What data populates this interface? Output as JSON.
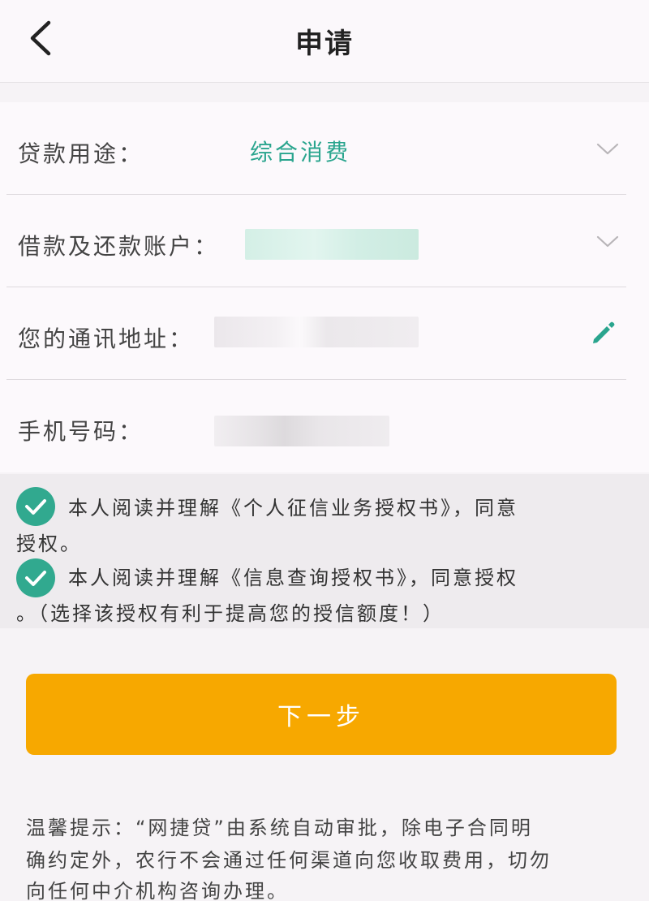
{
  "header": {
    "title": "申请",
    "back_icon": "chevron-left-icon"
  },
  "form": {
    "purpose": {
      "label": "贷款用途：",
      "value": "综合消费",
      "icon": "chevron-down-icon"
    },
    "account": {
      "label": "借款及还款账户：",
      "value": "",
      "icon": "chevron-down-icon"
    },
    "address": {
      "label": "您的通讯地址：",
      "value": "",
      "icon": "pencil-icon"
    },
    "phone": {
      "label": "手机号码：",
      "value": ""
    }
  },
  "consents": [
    {
      "line1": "本人阅读并理解《个人征信业务授权书》，同意",
      "line2": "授权。",
      "checked": true
    },
    {
      "line1": "本人阅读并理解《信息查询授权书》，同意授权",
      "line2": "。（选择该授权有利于提高您的授信额度！）",
      "checked": true
    }
  ],
  "next_button": {
    "label": "下一步"
  },
  "tip": {
    "line1": "温馨提示：“网捷贷”由系统自动审批，除电子合同明",
    "line2": "确约定外，农行不会通过任何渠道向您收取费用，切勿",
    "line3": "向任何中介机构咨询办理。"
  },
  "colors": {
    "accent": "#2aa58e",
    "check": "#31a98f",
    "button": "#f7a800"
  }
}
